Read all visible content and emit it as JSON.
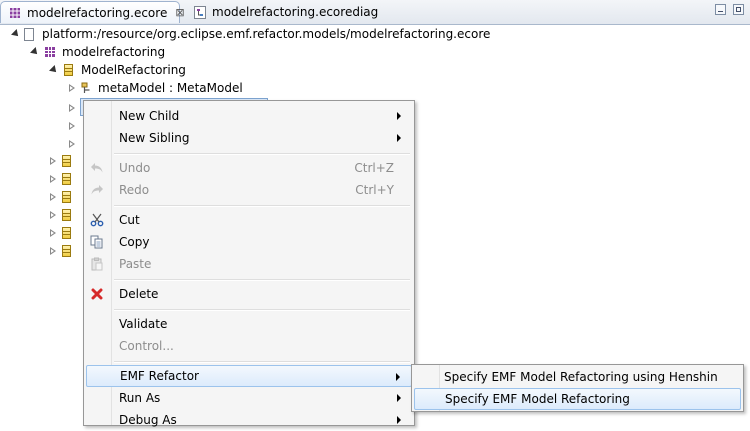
{
  "tabs": [
    {
      "label": "modelrefactoring.ecore",
      "active": true,
      "close": "⊠"
    },
    {
      "label": "modelrefactoring.ecorediag",
      "active": false
    }
  ],
  "tree": {
    "resource": "platform:/resource/org.eclipse.emf.refactor.models/modelrefactoring.ecore",
    "package": "modelrefactoring",
    "class": "ModelRefactoring",
    "reference": "metaModel : MetaModel"
  },
  "menu": {
    "new_child": "New Child",
    "new_sibling": "New Sibling",
    "undo": "Undo",
    "undo_shortcut": "Ctrl+Z",
    "redo": "Redo",
    "redo_shortcut": "Ctrl+Y",
    "cut": "Cut",
    "copy": "Copy",
    "paste": "Paste",
    "delete": "Delete",
    "validate": "Validate",
    "control": "Control...",
    "emf_refactor": "EMF Refactor",
    "run_as": "Run As",
    "debug_as": "Debug As"
  },
  "submenu": {
    "henshin": "Specify EMF Model Refactoring using Henshin",
    "specify": "Specify EMF Model Refactoring"
  },
  "colors": {
    "highlight_border": "#9cc3ec",
    "delete_icon": "#d62a2a",
    "package_icon": "#8a3fa0"
  }
}
